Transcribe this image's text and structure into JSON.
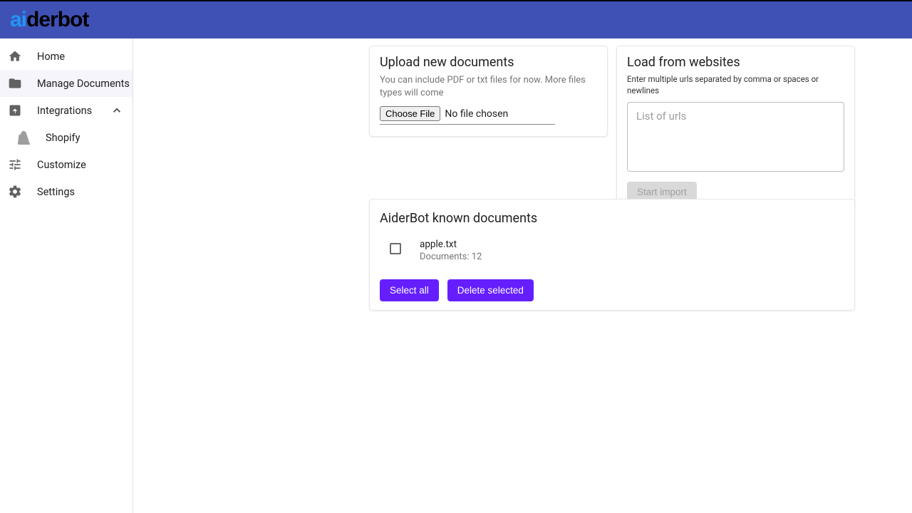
{
  "brand": {
    "prefix": "ai",
    "suffix": "derbot"
  },
  "sidebar": {
    "items": [
      {
        "label": "Home"
      },
      {
        "label": "Manage Documents"
      },
      {
        "label": "Integrations"
      },
      {
        "label": "Shopify"
      },
      {
        "label": "Customize"
      },
      {
        "label": "Settings"
      }
    ]
  },
  "upload": {
    "title": "Upload new documents",
    "hint": "You can include PDF or txt files for now. More files types will come",
    "choose_label": "Choose File",
    "no_file_label": "No file chosen"
  },
  "load": {
    "title": "Load from websites",
    "hint": "Enter multiple urls separated by comma or spaces or newlines",
    "placeholder": "List of urls",
    "start_label": "Start import"
  },
  "known": {
    "title": "AiderBot known documents",
    "docs": [
      {
        "name": "apple.txt",
        "sub": "Documents: 12"
      }
    ],
    "select_all_label": "Select all",
    "delete_label": "Delete selected"
  }
}
